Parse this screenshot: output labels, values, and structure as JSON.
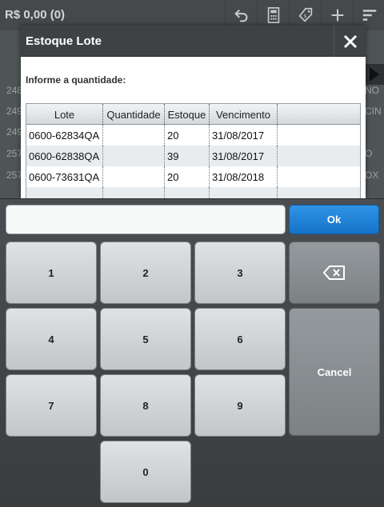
{
  "topbar": {
    "total": "R$ 0,00 (0)",
    "icons": [
      "undo-icon",
      "calculator-icon",
      "tag-icon",
      "plus-icon",
      "filter-icon"
    ]
  },
  "background": {
    "rows": [
      {
        "left": "248",
        "right": "NO"
      },
      {
        "left": "249",
        "right": "CIN"
      },
      {
        "left": "249",
        "right": ""
      },
      {
        "left": "257",
        "right": "O"
      },
      {
        "left": "257",
        "right": "OX"
      }
    ]
  },
  "modal": {
    "title": "Estoque Lote",
    "prompt": "Informe a quantidade:",
    "columns": [
      "Lote",
      "Quantidade",
      "Estoque",
      "Vencimento"
    ],
    "rows": [
      {
        "lote": "0600-62834QA",
        "quantidade": "",
        "estoque": "20",
        "vencimento": "31/08/2017"
      },
      {
        "lote": "0600-62838QA",
        "quantidade": "",
        "estoque": "39",
        "vencimento": "31/08/2017"
      },
      {
        "lote": "0600-73631QA",
        "quantidade": "",
        "estoque": "20",
        "vencimento": "31/08/2018"
      }
    ]
  },
  "keypad": {
    "input_value": "",
    "ok": "Ok",
    "cancel": "Cancel",
    "keys": [
      "1",
      "2",
      "3",
      "4",
      "5",
      "6",
      "7",
      "8",
      "9",
      "0"
    ]
  },
  "colors": {
    "accent": "#1f82d8",
    "header": "#3e4245"
  }
}
